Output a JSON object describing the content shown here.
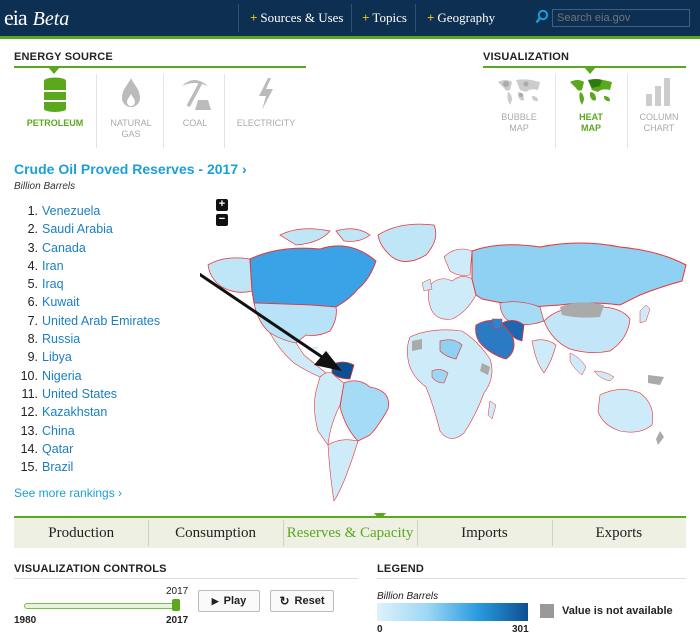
{
  "header": {
    "logo_text": "eia",
    "beta_label": "Beta",
    "nav": [
      "Sources & Uses",
      "Topics",
      "Geography"
    ],
    "search_placeholder": "Search eia.gov"
  },
  "energy_source": {
    "heading": "ENERGY SOURCE",
    "items": [
      {
        "label": "PETROLEUM",
        "active": true
      },
      {
        "label": "NATURAL GAS",
        "active": false
      },
      {
        "label": "COAL",
        "active": false
      },
      {
        "label": "ELECTRICITY",
        "active": false
      }
    ]
  },
  "visualization": {
    "heading": "VISUALIZATION",
    "items": [
      {
        "label": "BUBBLE MAP",
        "active": false
      },
      {
        "label": "HEAT MAP",
        "active": true
      },
      {
        "label": "COLUMN CHART",
        "active": false
      }
    ]
  },
  "chart": {
    "title": "Crude Oil Proved Reserves - 2017 ›",
    "unit": "Billion Barrels",
    "rankings": [
      "Venezuela",
      "Saudi Arabia",
      "Canada",
      "Iran",
      "Iraq",
      "Kuwait",
      "United Arab Emirates",
      "Russia",
      "Libya",
      "Nigeria",
      "United States",
      "Kazakhstan",
      "China",
      "Qatar",
      "Brazil"
    ],
    "see_more": "See more rankings ›",
    "zoom_in": "+",
    "zoom_out": "−"
  },
  "tabs": [
    "Production",
    "Consumption",
    "Reserves & Capacity",
    "Imports",
    "Exports"
  ],
  "active_tab": "Reserves & Capacity",
  "controls": {
    "heading": "VISUALIZATION CONTROLS",
    "year_current": "2017",
    "year_start": "1980",
    "year_end": "2017",
    "slider_fraction": 1.0,
    "play_label": "Play",
    "reset_label": "Reset"
  },
  "legend": {
    "heading": "LEGEND",
    "unit": "Billion Barrels",
    "min": "0",
    "max": "301",
    "na_label": "Value is not available"
  },
  "colors": {
    "navy": "#0d2f52",
    "green": "#5ba81e",
    "link_blue": "#1a9fd9"
  }
}
